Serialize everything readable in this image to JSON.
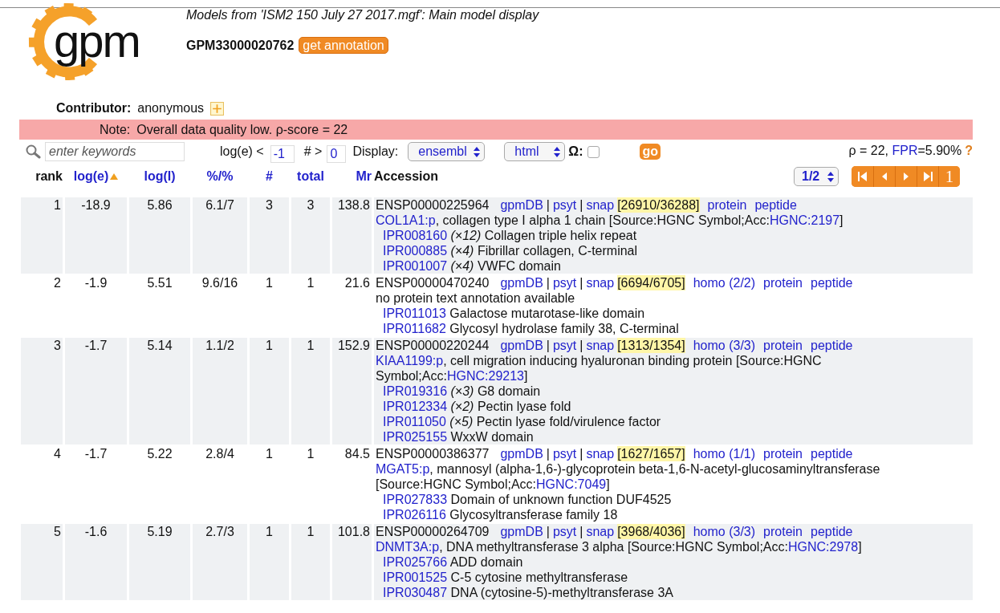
{
  "header": {
    "logo_text": "gpm",
    "title": "Models from 'ISM2 150 July 27 2017.mgf': Main model display",
    "model_id": "GPM33000020762",
    "annotation_button": "get annotation"
  },
  "contributor": {
    "label": "Contributor:",
    "value": "anonymous"
  },
  "note": {
    "label": "Note:",
    "text": "Overall data quality low. ρ-score = 22"
  },
  "toolbar": {
    "search_placeholder": "enter keywords",
    "loge_label": "log(e) <",
    "loge_value": "-1",
    "count_label": "# >",
    "count_value": "0",
    "display_label": "Display:",
    "display_select": "ensembl",
    "format_select": "html",
    "omega_label": "Ω:",
    "omega_checked": false,
    "go_button": "go",
    "stats_prefix": "ρ = 22, ",
    "fpr_link": "FPR",
    "stats_suffix": "=5.90%",
    "help": "?"
  },
  "table": {
    "columns": [
      {
        "label": "rank",
        "link": false,
        "sorted": false
      },
      {
        "label": "log(e)",
        "link": true,
        "sorted": true
      },
      {
        "label": "log(I)",
        "link": true,
        "sorted": false
      },
      {
        "label": "%/%",
        "link": true,
        "sorted": false
      },
      {
        "label": "#",
        "link": true,
        "sorted": false
      },
      {
        "label": "total",
        "link": true,
        "sorted": false
      },
      {
        "label": "Mr",
        "link": true,
        "sorted": false
      },
      {
        "label": "Accession",
        "link": false,
        "sorted": false
      }
    ],
    "page_select": "1/2",
    "pager": [
      {
        "kind": "first"
      },
      {
        "kind": "prev"
      },
      {
        "kind": "next"
      },
      {
        "kind": "last"
      },
      {
        "kind": "page",
        "label": "1"
      }
    ],
    "separator": "|",
    "rows": [
      {
        "rank": "1",
        "loge": "-18.9",
        "logi": "5.86",
        "pct": "6.1/7",
        "count": "3",
        "total": "3",
        "mr": "138.8",
        "accession": "ENSP00000225964",
        "links": [
          "gpmDB",
          "psyt",
          "snap"
        ],
        "snap": "[26910/36288]",
        "extra_links": [
          "protein",
          "peptide"
        ],
        "description": [
          {
            "text": "COL1A1:p",
            "link": true
          },
          {
            "text": ", collagen type I alpha 1 chain [Source:HGNC Symbol;Acc:",
            "link": false
          },
          {
            "text": "HGNC:2197",
            "link": true
          },
          {
            "text": "]",
            "link": false
          }
        ],
        "domains": [
          {
            "id": "IPR008160",
            "count": "(×12)",
            "name": "Collagen triple helix repeat"
          },
          {
            "id": "IPR000885",
            "count": "(×4)",
            "name": "Fibrillar collagen, C-terminal"
          },
          {
            "id": "IPR001007",
            "count": "(×4)",
            "name": "VWFC domain"
          }
        ]
      },
      {
        "rank": "2",
        "loge": "-1.9",
        "logi": "5.51",
        "pct": "9.6/16",
        "count": "1",
        "total": "1",
        "mr": "21.6",
        "accession": "ENSP00000470240",
        "links": [
          "gpmDB",
          "psyt",
          "snap"
        ],
        "snap": "[6694/6705]",
        "extra_links": [
          "homo (2/2)",
          "protein",
          "peptide"
        ],
        "description": [
          {
            "text": "no protein text annotation available",
            "link": false
          }
        ],
        "domains": [
          {
            "id": "IPR011013",
            "name": "Galactose mutarotase-like domain"
          },
          {
            "id": "IPR011682",
            "name": "Glycosyl hydrolase family 38, C-terminal"
          }
        ]
      },
      {
        "rank": "3",
        "loge": "-1.7",
        "logi": "5.14",
        "pct": "1.1/2",
        "count": "1",
        "total": "1",
        "mr": "152.9",
        "accession": "ENSP00000220244",
        "links": [
          "gpmDB",
          "psyt",
          "snap"
        ],
        "snap": "[1313/1354]",
        "extra_links": [
          "homo (3/3)",
          "protein",
          "peptide"
        ],
        "description": [
          {
            "text": "KIAA1199:p",
            "link": true
          },
          {
            "text": ", cell migration inducing hyaluronan binding protein [Source:HGNC Symbol;Acc:",
            "link": false
          },
          {
            "text": "HGNC:29213",
            "link": true
          },
          {
            "text": "]",
            "link": false
          }
        ],
        "domains": [
          {
            "id": "IPR019316",
            "count": "(×3)",
            "name": "G8 domain"
          },
          {
            "id": "IPR012334",
            "count": "(×2)",
            "name": "Pectin lyase fold"
          },
          {
            "id": "IPR011050",
            "count": "(×5)",
            "name": "Pectin lyase fold/virulence factor"
          },
          {
            "id": "IPR025155",
            "name": "WxxW domain"
          }
        ]
      },
      {
        "rank": "4",
        "loge": "-1.7",
        "logi": "5.22",
        "pct": "2.8/4",
        "count": "1",
        "total": "1",
        "mr": "84.5",
        "accession": "ENSP00000386377",
        "links": [
          "gpmDB",
          "psyt",
          "snap"
        ],
        "snap": "[1627/1657]",
        "extra_links": [
          "homo (1/1)",
          "protein",
          "peptide"
        ],
        "description": [
          {
            "text": "MGAT5:p",
            "link": true
          },
          {
            "text": ", mannosyl (alpha-1,6-)-glycoprotein beta-1,6-N-acetyl-glucosaminyltransferase [Source:HGNC Symbol;Acc:",
            "link": false
          },
          {
            "text": "HGNC:7049",
            "link": true
          },
          {
            "text": "]",
            "link": false
          }
        ],
        "domains": [
          {
            "id": "IPR027833",
            "name": "Domain of unknown function DUF4525"
          },
          {
            "id": "IPR026116",
            "name": "Glycosyltransferase family 18"
          }
        ]
      },
      {
        "rank": "5",
        "loge": "-1.6",
        "logi": "5.19",
        "pct": "2.7/3",
        "count": "1",
        "total": "1",
        "mr": "101.8",
        "accession": "ENSP00000264709",
        "links": [
          "gpmDB",
          "psyt",
          "snap"
        ],
        "snap": "[3968/4036]",
        "extra_links": [
          "homo (3/3)",
          "protein",
          "peptide"
        ],
        "description": [
          {
            "text": "DNMT3A:p",
            "link": true
          },
          {
            "text": ", DNA methyltransferase 3 alpha [Source:HGNC Symbol;Acc:",
            "link": false
          },
          {
            "text": "HGNC:2978",
            "link": true
          },
          {
            "text": "]",
            "link": false
          }
        ],
        "domains": [
          {
            "id": "IPR025766",
            "name": "ADD domain"
          },
          {
            "id": "IPR001525",
            "name": "C-5 cytosine methyltransferase"
          },
          {
            "id": "IPR030487",
            "name": "DNA (cytosine-5)-methyltransferase 3A"
          }
        ]
      }
    ]
  }
}
